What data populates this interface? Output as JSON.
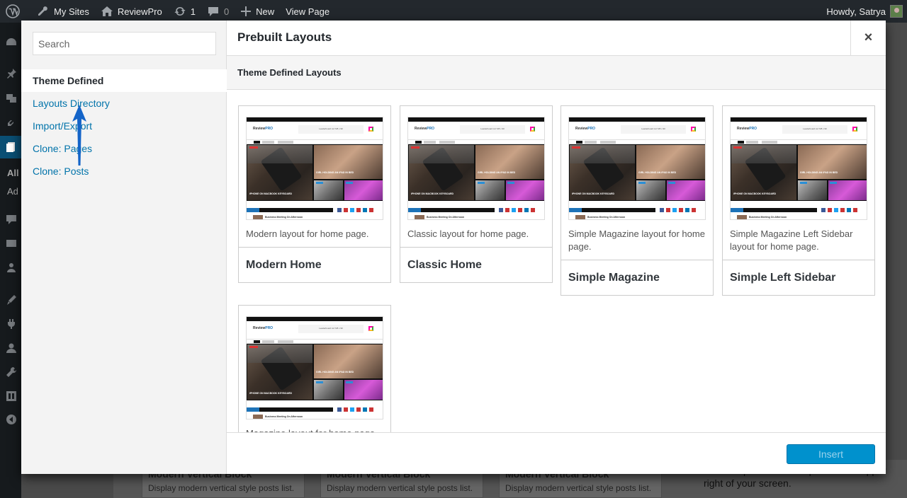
{
  "adminbar": {
    "my_sites": "My Sites",
    "site_name": "ReviewPro",
    "updates_count": "1",
    "comments_count": "0",
    "new_label": "New",
    "view_page": "View Page",
    "howdy": "Howdy, Satrya"
  },
  "admin_menu": {
    "sub_all": "All",
    "sub_add": "Ad"
  },
  "background": {
    "cards": [
      {
        "title": "Modern Vertical Block",
        "desc": "Display modern vertical style posts list."
      },
      {
        "title": "Modern Vertical Block",
        "desc": "Display modern vertical style posts list."
      },
      {
        "title": "Modern Vertical Block",
        "desc": "Display modern vertical style posts list."
      }
    ],
    "help_text": "Need help? Use the Help tab in the upper right of your screen."
  },
  "modal": {
    "search_placeholder": "Search",
    "nav": [
      {
        "label": "Theme Defined",
        "current": true
      },
      {
        "label": "Layouts Directory"
      },
      {
        "label": "Import/Export"
      },
      {
        "label": "Clone: Pages"
      },
      {
        "label": "Clone: Posts"
      }
    ],
    "title": "Prebuilt Layouts",
    "close_label": "×",
    "section_heading": "Theme Defined Layouts",
    "layouts": [
      {
        "desc": "Modern layout for home page.",
        "name": "Modern Home"
      },
      {
        "desc": "Classic layout for home page.",
        "name": "Classic Home"
      },
      {
        "desc": "Simple Magazine layout for home page.",
        "name": "Simple Magazine"
      },
      {
        "desc": "Simple Magazine Left Sidebar layout for home page.",
        "name": "Simple Left Sidebar"
      },
      {
        "desc": "Magazine layout for home page.",
        "name": ""
      }
    ],
    "insert_label": "Insert"
  },
  "thumbnail": {
    "logo_a": "Review",
    "logo_b": "PRO",
    "ad_text": "Leaderboard Ad 728 x 90",
    "hero_title": "iPHONE ON MACBOOK KEYBOARD",
    "side_title": "GIRL HOLDING AN iPAD IN BED",
    "foot_title": "Business Meeting On Afternoon"
  },
  "colors": {
    "link": "#0073aa",
    "button": "#0091cd",
    "adminbar": "#23282d"
  }
}
